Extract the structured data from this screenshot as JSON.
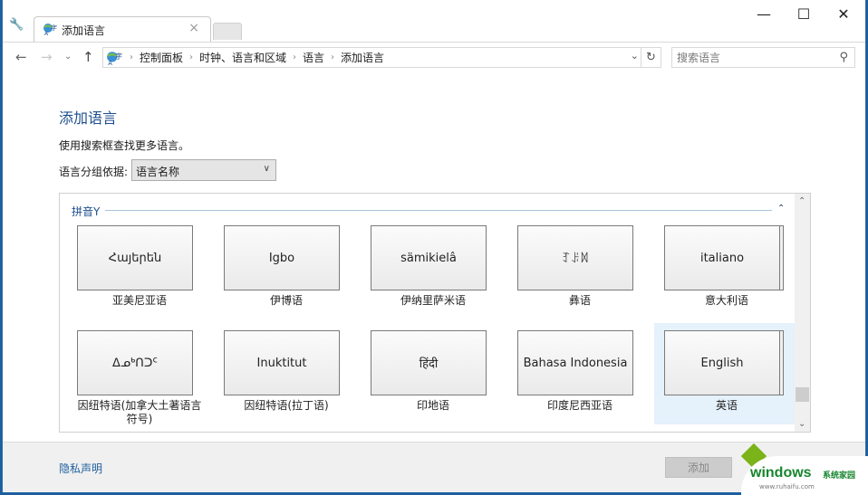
{
  "window": {
    "tab_title": "添加语言",
    "controls": {
      "minimize": "—",
      "maximize": "☐",
      "close": "✕"
    }
  },
  "nav": {
    "back": "←",
    "forward": "→",
    "recent": "⌄",
    "up": "↑",
    "breadcrumbs": [
      "控制面板",
      "时钟、语言和区域",
      "语言",
      "添加语言"
    ],
    "breadcrumb_separator": "›",
    "dropdown": "⌄",
    "refresh": "↻"
  },
  "search": {
    "placeholder": "搜索语言",
    "value": "",
    "icon": "search-icon"
  },
  "main": {
    "title": "添加语言",
    "hint": "使用搜索框查找更多语言。",
    "group_by_label": "语言分组依据:",
    "group_by_value": "语言名称",
    "section_header": "拼音Y",
    "collapse_icon": "⌃",
    "languages": [
      {
        "native": "Հայերեն",
        "name": "亚美尼亚语",
        "stacked": false,
        "selected": false
      },
      {
        "native": "Igbo",
        "name": "伊博语",
        "stacked": false,
        "selected": false
      },
      {
        "native": "sämikielâ",
        "name": "伊纳里萨米语",
        "stacked": false,
        "selected": false
      },
      {
        "native": "ꆈꌠꉙ",
        "name": "彝语",
        "stacked": false,
        "selected": false
      },
      {
        "native": "italiano",
        "name": "意大利语",
        "stacked": true,
        "selected": false
      },
      {
        "native": "ᐃᓄᒃᑎᑐᑦ",
        "name": "因纽特语(加拿大土著语言符号)",
        "stacked": false,
        "selected": false
      },
      {
        "native": "Inuktitut",
        "name": "因纽特语(拉丁语)",
        "stacked": false,
        "selected": false
      },
      {
        "native": "हिंदी",
        "name": "印地语",
        "stacked": false,
        "selected": false
      },
      {
        "native": "Bahasa Indonesia",
        "name": "印度尼西亚语",
        "stacked": false,
        "selected": false
      },
      {
        "native": "English",
        "name": "英语",
        "stacked": true,
        "selected": true
      }
    ]
  },
  "footer": {
    "privacy_link": "隐私声明",
    "add_button": "添加"
  },
  "watermark": {
    "brand": "windows",
    "brand_cn": "系统家园",
    "url": "www.ruhaifu.com"
  }
}
